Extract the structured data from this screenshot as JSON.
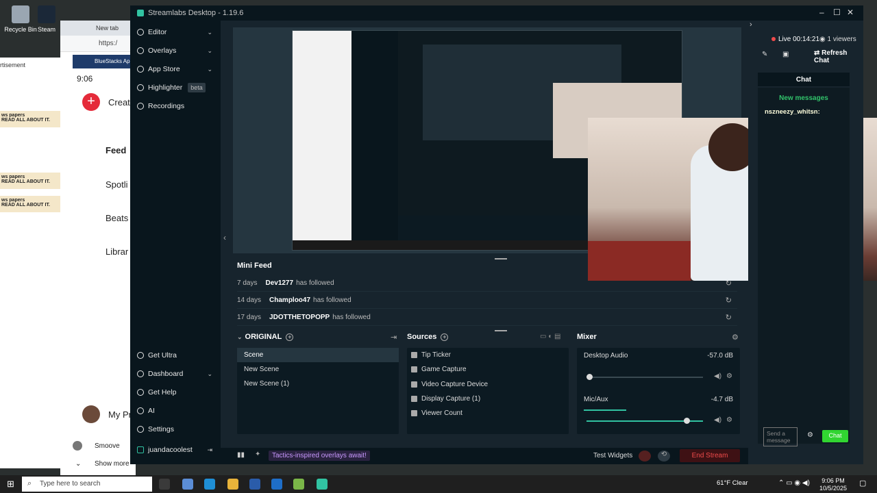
{
  "desktop": {
    "icons": [
      {
        "label": "Recycle Bin",
        "color": "#9aa6b2"
      },
      {
        "label": "Steam",
        "color": "#1b2838"
      }
    ],
    "ad_fragment": "rtisement",
    "ads": [
      "ws papers",
      "READ ALL ABOUT IT.",
      "ws papers",
      "READ ALL ABOUT IT.",
      "ws papers",
      "READ ALL ABOUT IT."
    ]
  },
  "browser": {
    "tab_label": "New tab",
    "address": "https:/"
  },
  "bluestacks": {
    "title": "BlueStacks Ap",
    "time": "9:06",
    "create_label": "Creat",
    "nav": [
      "Feed",
      "Spotli",
      "Beats",
      "Librar"
    ],
    "profile": "My Pr",
    "user_item": "Smoove",
    "show_more": "Show more"
  },
  "window": {
    "title": "Streamlabs Desktop - 1.19.6"
  },
  "sidebar": {
    "items": [
      {
        "label": "Editor",
        "expand": true
      },
      {
        "label": "Overlays",
        "expand": true
      },
      {
        "label": "App Store",
        "expand": true
      },
      {
        "label": "Highlighter",
        "badge": "beta"
      },
      {
        "label": "Recordings"
      }
    ],
    "bottom": [
      {
        "label": "Get Ultra"
      },
      {
        "label": "Dashboard",
        "expand": true
      },
      {
        "label": "Get Help"
      },
      {
        "label": "AI"
      },
      {
        "label": "Settings"
      }
    ],
    "account": "juandacoolest"
  },
  "minifeed": {
    "title": "Mini Feed",
    "rows": [
      {
        "age": "7 days",
        "user": "Dev1277",
        "action": "has followed"
      },
      {
        "age": "14 days",
        "user": "Champloo47",
        "action": "has followed"
      },
      {
        "age": "17 days",
        "user": "JDOTTHETOPOPP",
        "action": "has followed"
      }
    ]
  },
  "scenes": {
    "collection": "ORIGINAL",
    "items": [
      "Scene",
      "New Scene",
      "New Scene (1)"
    ],
    "active_index": 0
  },
  "sources": {
    "title": "Sources",
    "items": [
      {
        "label": "Tip Ticker",
        "icon": "dots-icon"
      },
      {
        "label": "Game Capture",
        "icon": "gamepad-icon"
      },
      {
        "label": "Video Capture Device",
        "icon": "camera-icon"
      },
      {
        "label": "Display Capture (1)",
        "icon": "monitor-icon"
      },
      {
        "label": "Viewer Count",
        "icon": "eye-icon"
      }
    ]
  },
  "mixer": {
    "title": "Mixer",
    "channels": [
      {
        "name": "Desktop Audio",
        "db": "-57.0 dB"
      },
      {
        "name": "Mic/Aux",
        "db": "-4.7 dB"
      }
    ]
  },
  "footer": {
    "promo": "Tactics-inspired overlays await!",
    "test_widgets": "Test Widgets",
    "end_stream": "End Stream"
  },
  "chat_panel": {
    "live": "Live 00:14:21",
    "viewers": "1 viewers",
    "refresh": "Refresh Chat",
    "title": "Chat",
    "new_messages": "New messages",
    "chat_user": "nszneezy_whitsn:",
    "send_placeholder": "Send a message",
    "chat_button": "Chat"
  },
  "taskbar": {
    "search_placeholder": "Type here to search",
    "weather": "61°F  Clear",
    "time": "9:06 PM",
    "date": "10/5/2025"
  },
  "colors": {
    "accent": "#31c3a2",
    "live_red": "#f04b4b",
    "chat_green": "#31d531",
    "promo_purple": "#c999ff"
  }
}
